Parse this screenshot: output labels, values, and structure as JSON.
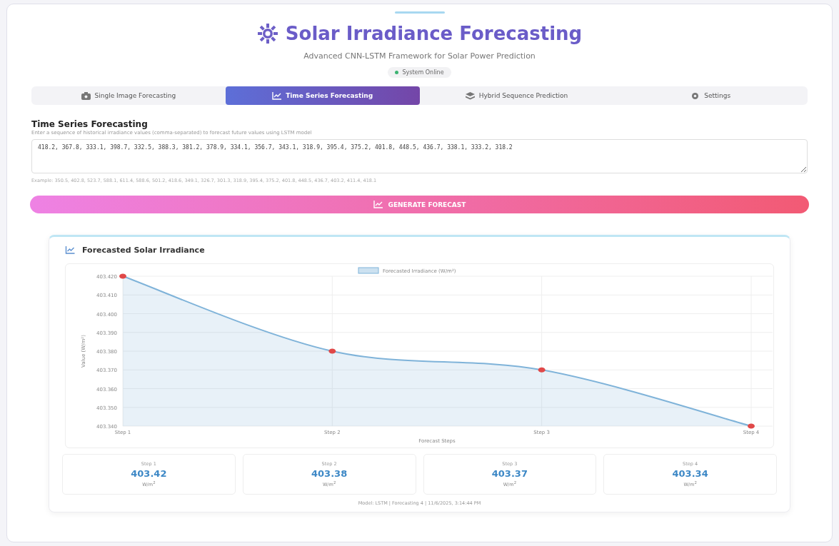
{
  "header": {
    "title": "Solar Irradiance Forecasting",
    "subtitle": "Advanced CNN-LSTM Framework for Solar Power Prediction",
    "status": {
      "label": "System Online",
      "online": true
    }
  },
  "tabs": [
    {
      "label": "Single Image Forecasting",
      "kind": "camera",
      "selected": false
    },
    {
      "label": "Time Series Forecasting",
      "kind": "chart",
      "selected": true
    },
    {
      "label": "Hybrid Sequence Prediction",
      "kind": "layers",
      "selected": false
    },
    {
      "label": "Settings",
      "kind": "gear",
      "selected": false
    }
  ],
  "section": {
    "title": "Time Series Forecasting",
    "description": "Enter a sequence of historical irradiance values (comma-separated) to forecast future values using LSTM model",
    "input": {
      "value": "418.2, 367.8, 333.1, 398.7, 332.5, 388.3, 381.2, 378.9, 334.1, 356.7, 343.1, 318.9, 395.4, 375.2, 401.8, 448.5, 436.7, 338.1, 333.2, 318.2"
    },
    "example": "Example: 350.5, 402.8, 523.7, 588.1, 611.4, 588.6, 501.2, 418.6, 349.1, 326.7, 301.3, 318.9, 395.4, 375.2, 401.8, 448.5, 436.7, 403.2, 411.4, 418.1"
  },
  "generate_button": {
    "label": "GENERATE FORECAST"
  },
  "results": {
    "title": "Forecasted Solar Irradiance",
    "chart_data": {
      "type": "area",
      "grid": true,
      "xlabel": "Forecast Steps",
      "ylabel": "Value (W/m²)",
      "categories": [
        "Step 1",
        "Step 2",
        "Step 3",
        "Step 4"
      ],
      "series": [
        {
          "name": "Forecasted Irradiance (W/m²)",
          "color": "#7fb3d9",
          "values": [
            403.42,
            403.38,
            403.37,
            403.34
          ]
        }
      ],
      "ylim": [
        403.34,
        403.42
      ],
      "yticks": [
        {
          "value": 403.42,
          "label": "403.420"
        },
        {
          "value": 403.41,
          "label": "403.410"
        },
        {
          "value": 403.4,
          "label": "403.400"
        },
        {
          "value": 403.39,
          "label": "403.390"
        },
        {
          "value": 403.38,
          "label": "403.380"
        },
        {
          "value": 403.37,
          "label": "403.370"
        },
        {
          "value": 403.36,
          "label": "403.360"
        },
        {
          "value": 403.35,
          "label": "403.350"
        },
        {
          "value": 403.34,
          "label": "403.340"
        }
      ]
    },
    "steps": [
      {
        "label": "Step 1",
        "value": "403.42",
        "unit": "W/m$^{2}$"
      },
      {
        "label": "Step 2",
        "value": "403.38",
        "unit": "W/m$^{2}$"
      },
      {
        "label": "Step 3",
        "value": "403.37",
        "unit": "W/m$^{2}$"
      },
      {
        "label": "Step 4",
        "value": "403.34",
        "unit": "W/m$^{2}$"
      }
    ],
    "footer": "Model: LSTM | Forecasting 4 | 11/6/2025, 3:14:44 PM"
  }
}
